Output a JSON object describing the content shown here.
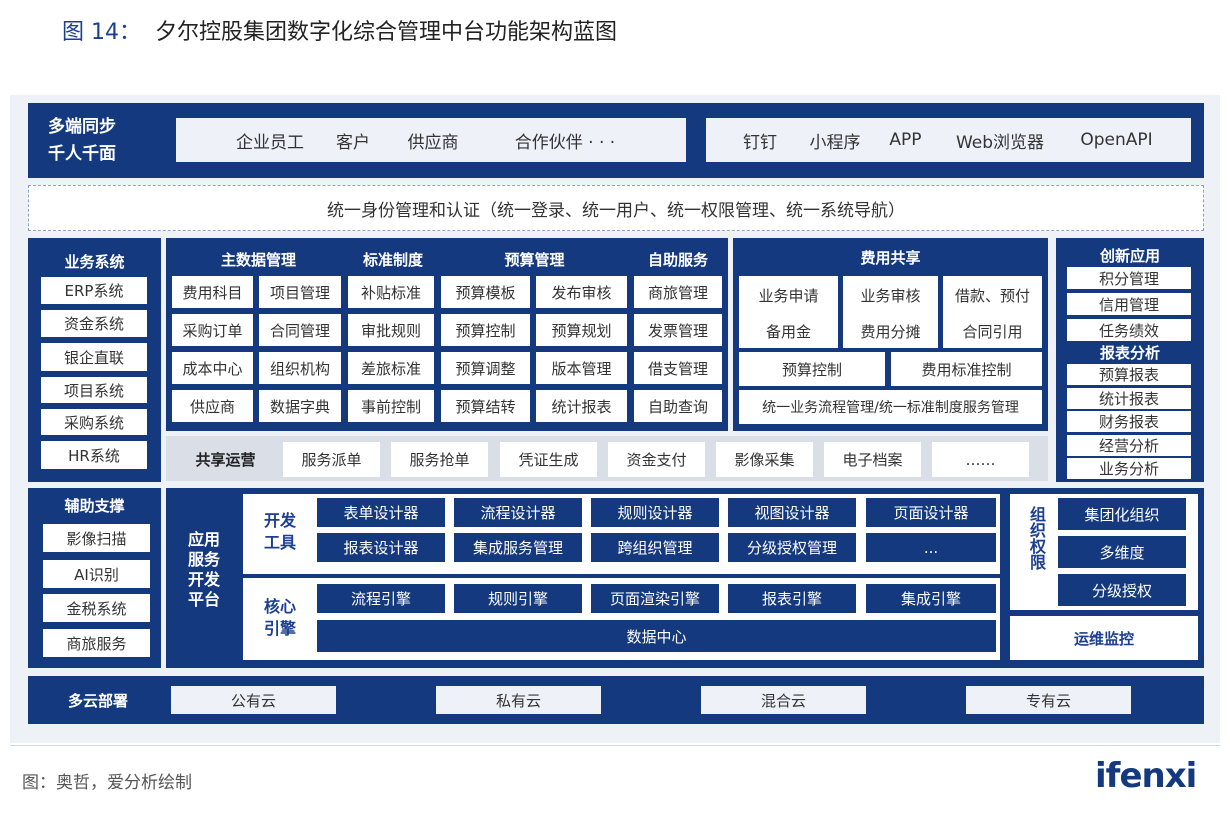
{
  "figure": {
    "number": "图 14：",
    "title": "夕尔控股集团数字化综合管理中台功能架构蓝图"
  },
  "top": {
    "label_line1": "多端同步",
    "label_line2": "千人千面",
    "users": [
      "企业员工",
      "客户",
      "供应商",
      "合作伙伴 · · ·"
    ],
    "channels": [
      "钉钉",
      "小程序",
      "APP",
      "Web浏览器",
      "OpenAPI"
    ]
  },
  "identity": "统一身份管理和认证（统一登录、统一用户、统一权限管理、统一系统导航）",
  "business": {
    "title": "业务系统",
    "items": [
      "ERP系统",
      "资金系统",
      "银企直联",
      "项目系统",
      "采购系统",
      "HR系统"
    ]
  },
  "master": {
    "headers": [
      "主数据管理",
      "标准制度",
      "预算管理",
      "自助服务"
    ],
    "rows": [
      [
        "费用科目",
        "项目管理",
        "补贴标准",
        "预算模板",
        "发布审核",
        "商旅管理"
      ],
      [
        "采购订单",
        "合同管理",
        "审批规则",
        "预算控制",
        "预算规划",
        "发票管理"
      ],
      [
        "成本中心",
        "组织机构",
        "差旅标准",
        "预算调整",
        "版本管理",
        "借支管理"
      ],
      [
        "供应商",
        "数据字典",
        "事前控制",
        "预算结转",
        "统计报表",
        "自助查询"
      ]
    ]
  },
  "expense": {
    "title": "费用共享",
    "row1": [
      "业务申请",
      "业务审核",
      "借款、预付"
    ],
    "row2": [
      "备用金",
      "费用分摊",
      "合同引用"
    ],
    "row3": [
      "预算控制",
      "费用标准控制"
    ],
    "row4": "统一业务流程管理/统一标准制度服务管理"
  },
  "shared_ops": {
    "title": "共享运营",
    "items": [
      "服务派单",
      "服务抢单",
      "凭证生成",
      "资金支付",
      "影像采集",
      "电子档案",
      "……"
    ]
  },
  "innovation": {
    "title": "创新应用",
    "items": [
      "积分管理",
      "信用管理",
      "任务绩效"
    ],
    "report_title": "报表分析",
    "reports": [
      "预算报表",
      "统计报表",
      "财务报表",
      "经营分析",
      "业务分析"
    ]
  },
  "support": {
    "title": "辅助支撑",
    "items": [
      "影像扫描",
      "AI识别",
      "金税系统",
      "商旅服务"
    ]
  },
  "platform": {
    "title": [
      "应用",
      "服务",
      "开发",
      "平台"
    ],
    "dev_tools_label": [
      "开发",
      "工具"
    ],
    "dev_row1": [
      "表单设计器",
      "流程设计器",
      "规则设计器",
      "视图设计器",
      "页面设计器"
    ],
    "dev_row2": [
      "报表设计器",
      "集成服务管理",
      "跨组织管理",
      "分级授权管理",
      "..."
    ],
    "engine_label": [
      "核心",
      "引擎"
    ],
    "engines": [
      "流程引擎",
      "规则引擎",
      "页面渲染引擎",
      "报表引擎",
      "集成引擎"
    ],
    "data_center": "数据中心"
  },
  "org": {
    "title": "组织权限",
    "items": [
      "集团化组织",
      "多维度",
      "分级授权"
    ],
    "ops": "运维监控"
  },
  "cloud": {
    "title": "多云部署",
    "items": [
      "公有云",
      "私有云",
      "混合云",
      "专有云"
    ]
  },
  "source": "图：奥哲，爱分析绘制",
  "logo": "ifenxi",
  "colors": {
    "dark_blue": "#14397e",
    "pale": "#eef2f8"
  }
}
